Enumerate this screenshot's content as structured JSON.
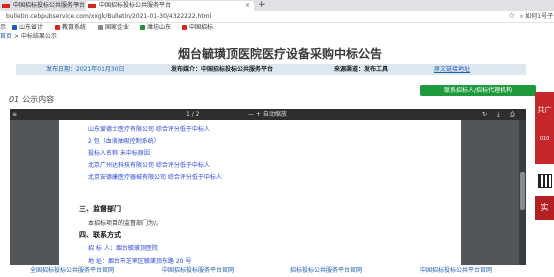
{
  "browser": {
    "tabs": [
      {
        "label": "中国招标投标公共服务平台",
        "close": "×"
      },
      {
        "label": "中国招标投标公共服务平台",
        "close": "×"
      }
    ],
    "new_tab": "+",
    "url": "bulletin.cebpubservice.com/xxgk/Bulletin/2021-01-30/4322222.html",
    "search_text": "如何1号子",
    "bookmarks": [
      "示",
      "山东省计",
      "教育系统",
      "国家企业",
      "潍坊山东",
      "中国招标"
    ]
  },
  "breadcrumb": {
    "home": "首页",
    "sep": ">",
    "current": "中标结果公示"
  },
  "notice": {
    "title": "烟台毓璜顶医院医疗设备采购中标公告",
    "date": "发布日期：2021年01月30日",
    "publisher": "发布媒介：中国招标投标公共服务平台",
    "source": "来源渠道：发布工具",
    "original_link": "原文链接地址",
    "contact_button": "联系招标人/招标代理机构",
    "section_num": "01",
    "section_label": "公示内容"
  },
  "pdf_viewer": {
    "menu": "≡",
    "page": "1 / 2",
    "zoom": "—  +  自动缩放",
    "rotate": "↻",
    "download": "⤓",
    "print": "⎙"
  },
  "pdf_content": {
    "lines": [
      "山东爱德士医疗有限公司 综合评分低于中标人",
      "2 包（血液抽吸控制系统）",
      "投标人名称                                          未中标原因",
      "北京广州达科技有限公司 综合评分低于中标人",
      "北京安德康医疗器械有限公司 综合评分低于中标人"
    ],
    "section3": "三、监督部门",
    "section3_body": "本招标项目的监督部门为/。",
    "section4": "四、联系方式",
    "contact_line1": "招 标 人：烟台毓璜顶医院",
    "contact_line2": "地    址：烟台市芝罘区毓璜顶东路 20 号"
  },
  "sidebar_ads": {
    "ad1": "共广",
    "ad1_sub": "010",
    "ad2": "实"
  },
  "footer_links": [
    "全国招标投标公共服务平台官网",
    "中国招标投标服务平台官网",
    "招标投标公共服务平台官网",
    "中国招标投标公共平台官网"
  ]
}
